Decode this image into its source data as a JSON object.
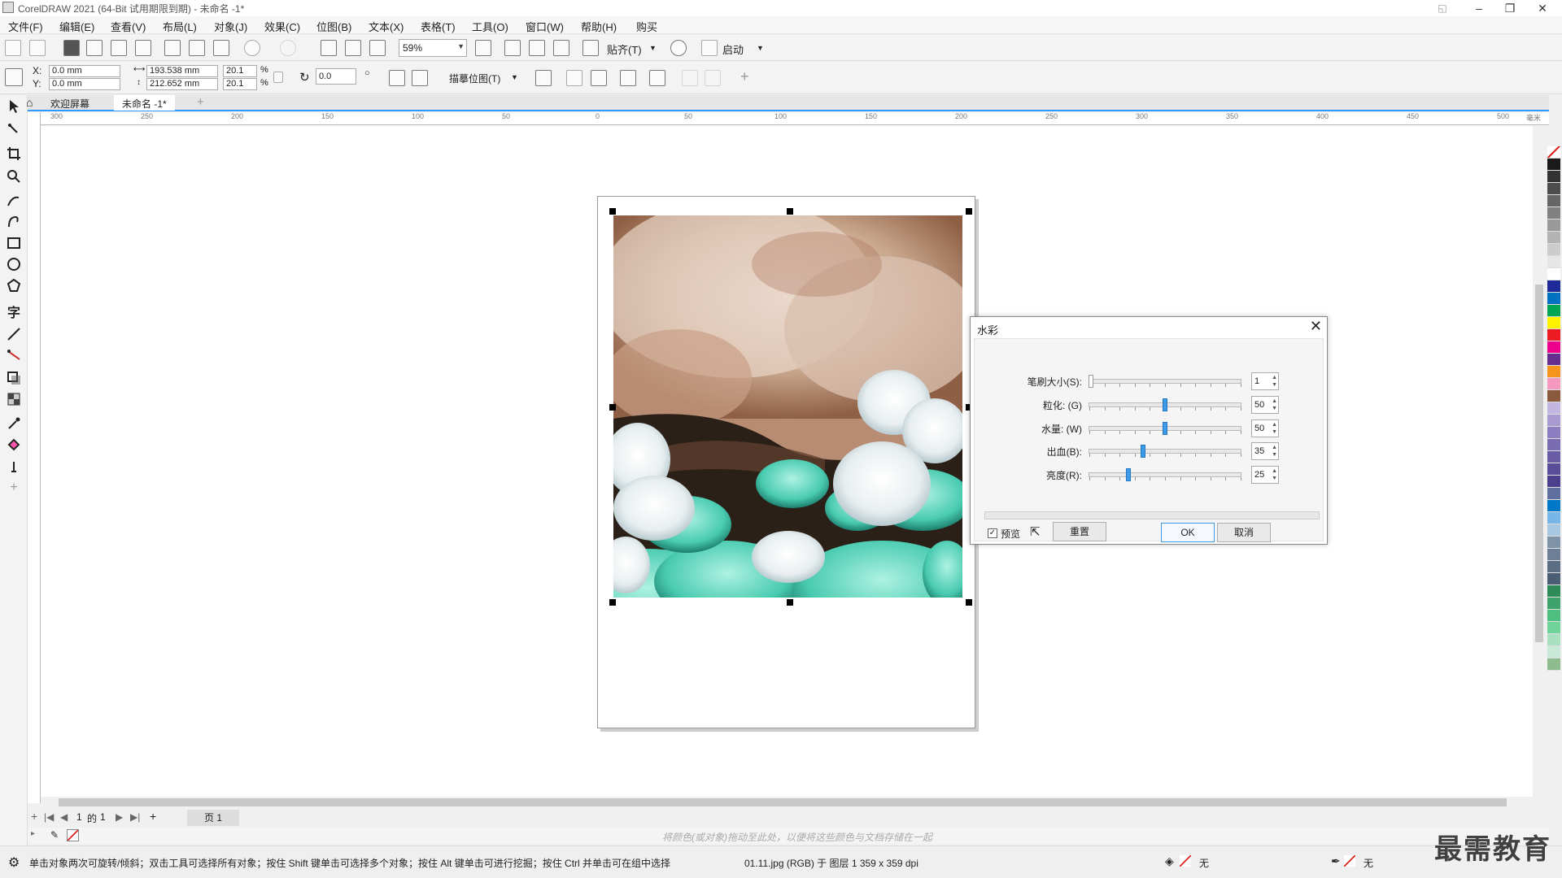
{
  "window": {
    "title": "CorelDRAW 2021 (64-Bit 试用期限到期) - 未命名 -1*"
  },
  "menu": [
    "文件(F)",
    "编辑(E)",
    "查看(V)",
    "布局(L)",
    "对象(J)",
    "效果(C)",
    "位图(B)",
    "文本(X)",
    "表格(T)",
    "工具(O)",
    "窗口(W)",
    "帮助(H)",
    "购买"
  ],
  "toolbar": {
    "zoom": "59%",
    "snap_label": "贴齐(T)",
    "launch_label": "启动"
  },
  "propbar": {
    "x_label": "X:",
    "y_label": "Y:",
    "x_value": "0.0 mm",
    "y_value": "0.0 mm",
    "width": "193.538 mm",
    "height": "212.652 mm",
    "scale_x": "20.1",
    "scale_y": "20.1",
    "percent": "%",
    "rotation": "0.0",
    "trace_label": "描摹位图(T)"
  },
  "tabs": {
    "welcome": "欢迎屏幕",
    "document": "未命名 -1*"
  },
  "ruler": {
    "h_labels": [
      "300",
      "250",
      "200",
      "150",
      "100",
      "50",
      "0",
      "50",
      "100",
      "150",
      "200",
      "250",
      "300",
      "350",
      "400",
      "450",
      "500"
    ],
    "h_unit": "毫米"
  },
  "dialog": {
    "title": "水彩",
    "sliders": [
      {
        "label": "笔刷大小(S):",
        "value": "1",
        "level": 0.0
      },
      {
        "label": "粒化: (G)",
        "value": "50",
        "level": 0.5
      },
      {
        "label": "水量: (W)",
        "value": "50",
        "level": 0.5
      },
      {
        "label": "出血(B):",
        "value": "35",
        "level": 0.35
      },
      {
        "label": "亮度(R):",
        "value": "25",
        "level": 0.25
      }
    ],
    "preview_label": "预览",
    "reset_label": "重置",
    "ok_label": "OK",
    "cancel_label": "取消"
  },
  "pagenav": {
    "page_current": "1",
    "page_of": "的",
    "page_total": "1",
    "page_tab": "页 1"
  },
  "colorstrip": {
    "hint": "将颜色(或对象)拖动至此处，以便将这些颜色与文档存储在一起"
  },
  "status": {
    "message": "单击对象两次可旋转/倾斜；双击工具可选择所有对象；按住 Shift 键单击可选择多个对象；按住 Alt 键单击可进行挖掘；按住 Ctrl 并单击可在组中选择",
    "object_info": "01.11.jpg (RGB) 于 图层 1 359 x 359 dpi",
    "fill_label": "无",
    "outline_label": "无"
  },
  "watermark": "最需教育",
  "palette": [
    "#1a1a1a",
    "#333333",
    "#4d4d4d",
    "#666666",
    "#808080",
    "#999999",
    "#b3b3b3",
    "#cccccc",
    "#e6e6e6",
    "#ffffff",
    "#1c2a9a",
    "#0070c0",
    "#00a651",
    "#fff200",
    "#ed1c24",
    "#ec008c",
    "#662d91",
    "#f7941d",
    "#f49ac1",
    "#8b5a3c",
    "#c2b5e0",
    "#a99ad0",
    "#8c7cc0",
    "#7a6cb0",
    "#6a5ca4",
    "#5a4d98",
    "#4a408c",
    "#5f6f9f",
    "#0078c8",
    "#76b6e8",
    "#a7c8e0",
    "#7f93a8",
    "#6c7f96",
    "#5c6e84",
    "#4b5d72",
    "#2e8b57",
    "#3da36b",
    "#4fbf7f",
    "#6fd39a",
    "#a8e0c0",
    "#c8e8d8",
    "#8fbc8f"
  ]
}
